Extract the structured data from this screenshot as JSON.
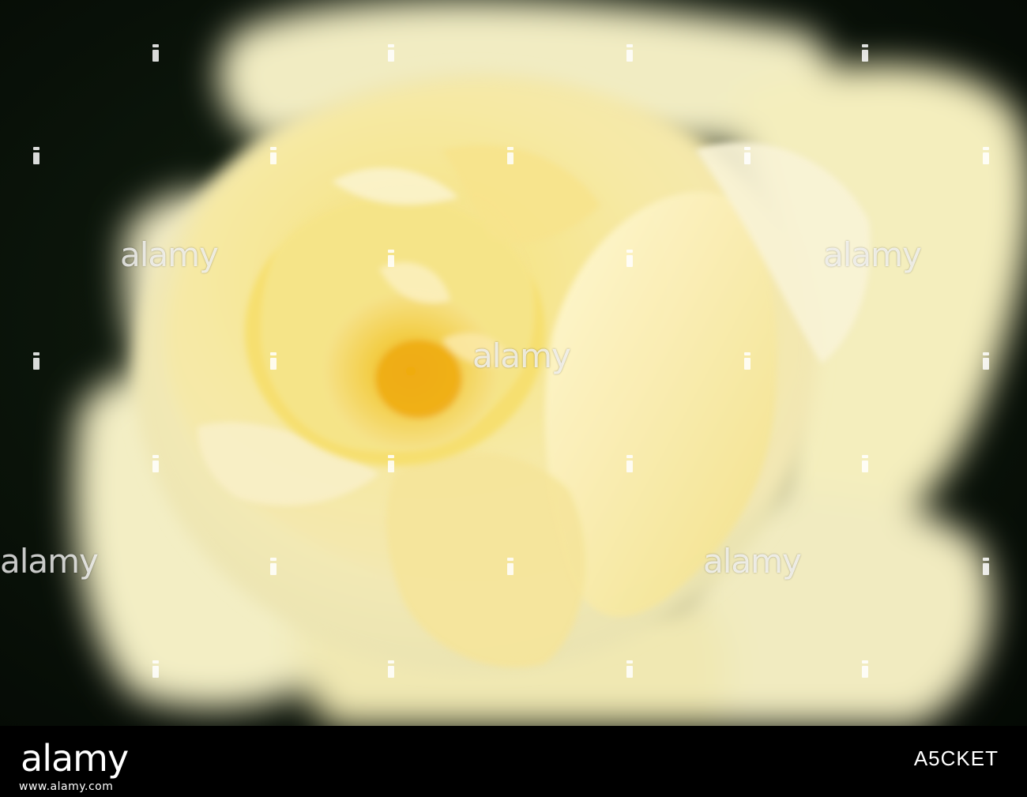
{
  "photo": {
    "subject": "yellow-rose",
    "colors": {
      "background_dark": "#0a140a",
      "petal_outer": "#fbf4c4",
      "petal_mid": "#f6e99a",
      "petal_inner": "#f2d65a",
      "center": "#f0b820"
    }
  },
  "watermark": {
    "text": "alamy"
  },
  "footer": {
    "logo": "alamy",
    "url": "www.alamy.com",
    "image_id": "A5CKET"
  }
}
